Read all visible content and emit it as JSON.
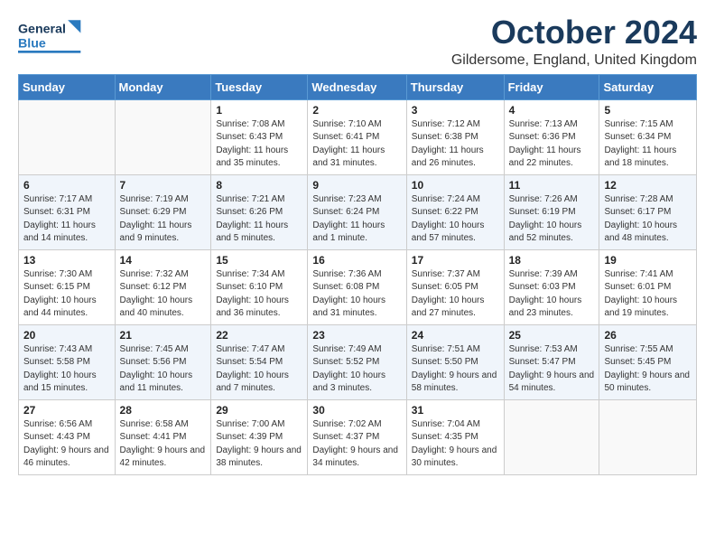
{
  "header": {
    "logo_general": "General",
    "logo_blue": "Blue",
    "month_title": "October 2024",
    "location": "Gildersome, England, United Kingdom"
  },
  "calendar": {
    "days_of_week": [
      "Sunday",
      "Monday",
      "Tuesday",
      "Wednesday",
      "Thursday",
      "Friday",
      "Saturday"
    ],
    "weeks": [
      [
        {
          "day": "",
          "sunrise": "",
          "sunset": "",
          "daylight": ""
        },
        {
          "day": "",
          "sunrise": "",
          "sunset": "",
          "daylight": ""
        },
        {
          "day": "1",
          "sunrise": "Sunrise: 7:08 AM",
          "sunset": "Sunset: 6:43 PM",
          "daylight": "Daylight: 11 hours and 35 minutes."
        },
        {
          "day": "2",
          "sunrise": "Sunrise: 7:10 AM",
          "sunset": "Sunset: 6:41 PM",
          "daylight": "Daylight: 11 hours and 31 minutes."
        },
        {
          "day": "3",
          "sunrise": "Sunrise: 7:12 AM",
          "sunset": "Sunset: 6:38 PM",
          "daylight": "Daylight: 11 hours and 26 minutes."
        },
        {
          "day": "4",
          "sunrise": "Sunrise: 7:13 AM",
          "sunset": "Sunset: 6:36 PM",
          "daylight": "Daylight: 11 hours and 22 minutes."
        },
        {
          "day": "5",
          "sunrise": "Sunrise: 7:15 AM",
          "sunset": "Sunset: 6:34 PM",
          "daylight": "Daylight: 11 hours and 18 minutes."
        }
      ],
      [
        {
          "day": "6",
          "sunrise": "Sunrise: 7:17 AM",
          "sunset": "Sunset: 6:31 PM",
          "daylight": "Daylight: 11 hours and 14 minutes."
        },
        {
          "day": "7",
          "sunrise": "Sunrise: 7:19 AM",
          "sunset": "Sunset: 6:29 PM",
          "daylight": "Daylight: 11 hours and 9 minutes."
        },
        {
          "day": "8",
          "sunrise": "Sunrise: 7:21 AM",
          "sunset": "Sunset: 6:26 PM",
          "daylight": "Daylight: 11 hours and 5 minutes."
        },
        {
          "day": "9",
          "sunrise": "Sunrise: 7:23 AM",
          "sunset": "Sunset: 6:24 PM",
          "daylight": "Daylight: 11 hours and 1 minute."
        },
        {
          "day": "10",
          "sunrise": "Sunrise: 7:24 AM",
          "sunset": "Sunset: 6:22 PM",
          "daylight": "Daylight: 10 hours and 57 minutes."
        },
        {
          "day": "11",
          "sunrise": "Sunrise: 7:26 AM",
          "sunset": "Sunset: 6:19 PM",
          "daylight": "Daylight: 10 hours and 52 minutes."
        },
        {
          "day": "12",
          "sunrise": "Sunrise: 7:28 AM",
          "sunset": "Sunset: 6:17 PM",
          "daylight": "Daylight: 10 hours and 48 minutes."
        }
      ],
      [
        {
          "day": "13",
          "sunrise": "Sunrise: 7:30 AM",
          "sunset": "Sunset: 6:15 PM",
          "daylight": "Daylight: 10 hours and 44 minutes."
        },
        {
          "day": "14",
          "sunrise": "Sunrise: 7:32 AM",
          "sunset": "Sunset: 6:12 PM",
          "daylight": "Daylight: 10 hours and 40 minutes."
        },
        {
          "day": "15",
          "sunrise": "Sunrise: 7:34 AM",
          "sunset": "Sunset: 6:10 PM",
          "daylight": "Daylight: 10 hours and 36 minutes."
        },
        {
          "day": "16",
          "sunrise": "Sunrise: 7:36 AM",
          "sunset": "Sunset: 6:08 PM",
          "daylight": "Daylight: 10 hours and 31 minutes."
        },
        {
          "day": "17",
          "sunrise": "Sunrise: 7:37 AM",
          "sunset": "Sunset: 6:05 PM",
          "daylight": "Daylight: 10 hours and 27 minutes."
        },
        {
          "day": "18",
          "sunrise": "Sunrise: 7:39 AM",
          "sunset": "Sunset: 6:03 PM",
          "daylight": "Daylight: 10 hours and 23 minutes."
        },
        {
          "day": "19",
          "sunrise": "Sunrise: 7:41 AM",
          "sunset": "Sunset: 6:01 PM",
          "daylight": "Daylight: 10 hours and 19 minutes."
        }
      ],
      [
        {
          "day": "20",
          "sunrise": "Sunrise: 7:43 AM",
          "sunset": "Sunset: 5:58 PM",
          "daylight": "Daylight: 10 hours and 15 minutes."
        },
        {
          "day": "21",
          "sunrise": "Sunrise: 7:45 AM",
          "sunset": "Sunset: 5:56 PM",
          "daylight": "Daylight: 10 hours and 11 minutes."
        },
        {
          "day": "22",
          "sunrise": "Sunrise: 7:47 AM",
          "sunset": "Sunset: 5:54 PM",
          "daylight": "Daylight: 10 hours and 7 minutes."
        },
        {
          "day": "23",
          "sunrise": "Sunrise: 7:49 AM",
          "sunset": "Sunset: 5:52 PM",
          "daylight": "Daylight: 10 hours and 3 minutes."
        },
        {
          "day": "24",
          "sunrise": "Sunrise: 7:51 AM",
          "sunset": "Sunset: 5:50 PM",
          "daylight": "Daylight: 9 hours and 58 minutes."
        },
        {
          "day": "25",
          "sunrise": "Sunrise: 7:53 AM",
          "sunset": "Sunset: 5:47 PM",
          "daylight": "Daylight: 9 hours and 54 minutes."
        },
        {
          "day": "26",
          "sunrise": "Sunrise: 7:55 AM",
          "sunset": "Sunset: 5:45 PM",
          "daylight": "Daylight: 9 hours and 50 minutes."
        }
      ],
      [
        {
          "day": "27",
          "sunrise": "Sunrise: 6:56 AM",
          "sunset": "Sunset: 4:43 PM",
          "daylight": "Daylight: 9 hours and 46 minutes."
        },
        {
          "day": "28",
          "sunrise": "Sunrise: 6:58 AM",
          "sunset": "Sunset: 4:41 PM",
          "daylight": "Daylight: 9 hours and 42 minutes."
        },
        {
          "day": "29",
          "sunrise": "Sunrise: 7:00 AM",
          "sunset": "Sunset: 4:39 PM",
          "daylight": "Daylight: 9 hours and 38 minutes."
        },
        {
          "day": "30",
          "sunrise": "Sunrise: 7:02 AM",
          "sunset": "Sunset: 4:37 PM",
          "daylight": "Daylight: 9 hours and 34 minutes."
        },
        {
          "day": "31",
          "sunrise": "Sunrise: 7:04 AM",
          "sunset": "Sunset: 4:35 PM",
          "daylight": "Daylight: 9 hours and 30 minutes."
        },
        {
          "day": "",
          "sunrise": "",
          "sunset": "",
          "daylight": ""
        },
        {
          "day": "",
          "sunrise": "",
          "sunset": "",
          "daylight": ""
        }
      ]
    ]
  }
}
